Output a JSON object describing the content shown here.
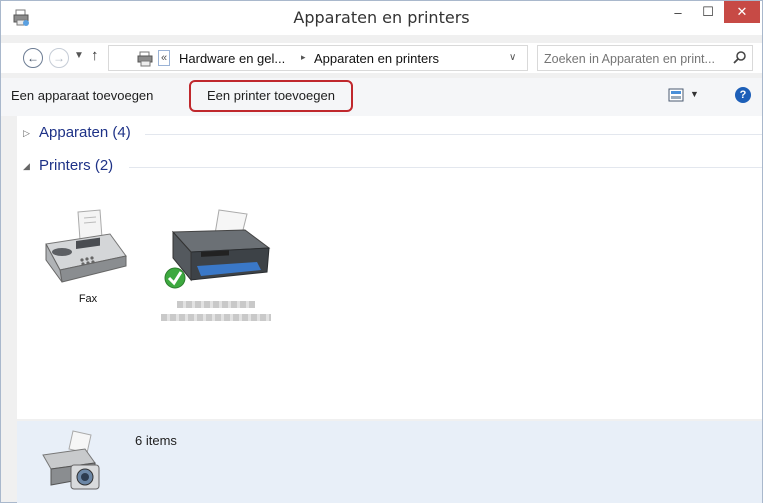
{
  "window": {
    "title": "Apparaten en printers",
    "close_label": "✕",
    "minimize_label": "–",
    "maximize_label": "☐"
  },
  "addressbar": {
    "back_icon": "back-arrow-icon",
    "forward_icon": "forward-arrow-icon",
    "chevron_label": "«",
    "breadcrumbs": [
      "Hardware en gel...",
      "Apparaten en printers"
    ],
    "separator": "▸",
    "search_placeholder": "Zoeken in Apparaten en print..."
  },
  "toolbar": {
    "add_device_label": "Een apparaat toevoegen",
    "add_printer_label": "Een printer toevoegen",
    "help_label": "?"
  },
  "groups": [
    {
      "label": "Apparaten (4)",
      "expanded": false,
      "arrow": "▷"
    },
    {
      "label": "Printers (2)",
      "expanded": true,
      "arrow": "◢"
    }
  ],
  "printers": [
    {
      "label": "Fax",
      "icon": "fax-icon"
    },
    {
      "label": "",
      "icon": "printer-icon",
      "default": true,
      "status_icon": "default-check-icon"
    }
  ],
  "details": {
    "count_label": "6 items"
  },
  "colors": {
    "accent": "#1e3287",
    "highlight_box": "#c0282d",
    "close_button": "#c74a45",
    "details_bg": "#e8eff8"
  }
}
